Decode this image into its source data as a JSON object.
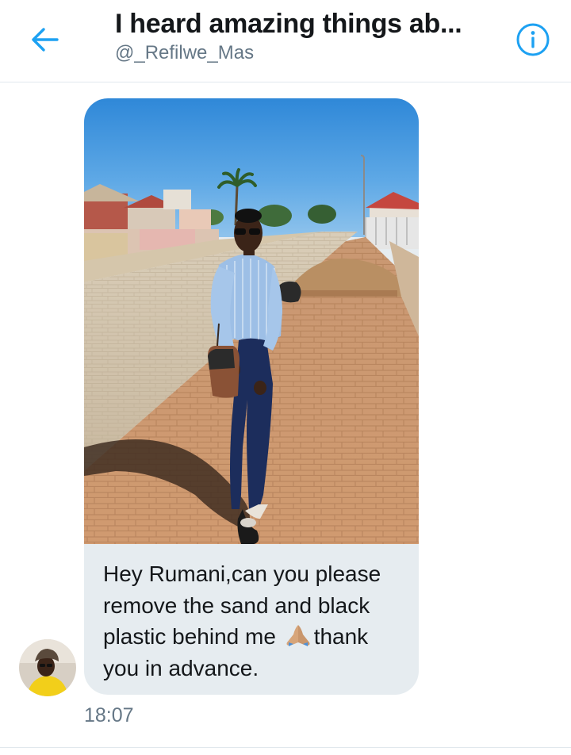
{
  "header": {
    "title": "I heard amazing things ab...",
    "handle": "@_Refilwe_Mas",
    "back_icon": "arrow-left-icon",
    "info_icon": "info-icon",
    "accent_color": "#1da1f2"
  },
  "message": {
    "text_before_emoji": "Hey Rumani,can you please remove the sand and black plastic behind me ",
    "text_after_emoji": "thank you in advance.",
    "emoji": "folded-hands-icon",
    "timestamp": "18:07"
  },
  "colors": {
    "bubble_bg": "#e6ecf0",
    "secondary_text": "#657786",
    "primary_text": "#14171a"
  }
}
